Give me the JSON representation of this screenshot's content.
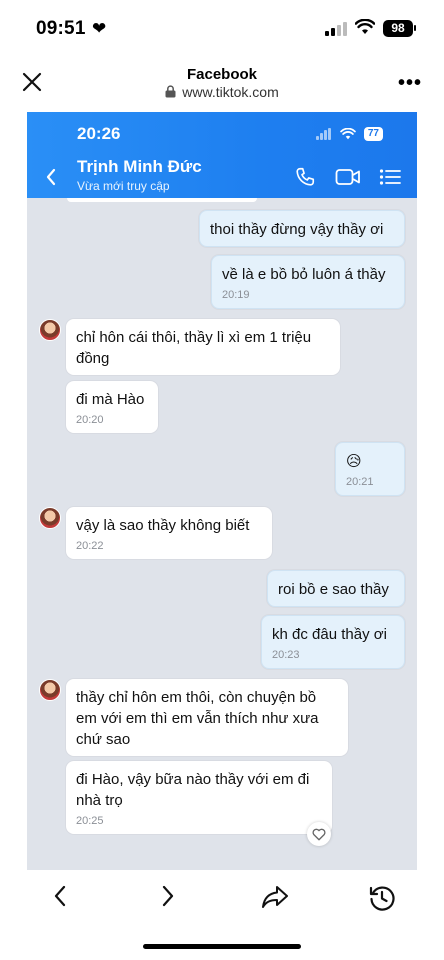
{
  "status_bar": {
    "time": "09:51",
    "battery": "98"
  },
  "browser": {
    "title": "Facebook",
    "url": "www.tiktok.com"
  },
  "chat": {
    "time": "20:26",
    "battery": "77",
    "contact_name": "Trịnh Minh Đức",
    "contact_status": "Vừa mới truy cập",
    "messages": [
      {
        "dir": "out",
        "text": "thoi thầy đừng vậy thầy ơi",
        "time": ""
      },
      {
        "dir": "out",
        "text": "về là e bồ bỏ luôn á thầy",
        "time": "20:19"
      },
      {
        "dir": "in",
        "text": "chỉ hôn cái thôi, thầy lì xì em 1 triệu đồng",
        "time": ""
      },
      {
        "dir": "in",
        "text": "đi mà Hào",
        "time": "20:20"
      },
      {
        "dir": "out",
        "text": "😥",
        "time": "20:21"
      },
      {
        "dir": "in",
        "text": "vậy là sao thầy không biết",
        "time": "20:22"
      },
      {
        "dir": "out",
        "text": "roi bồ e sao thầy",
        "time": ""
      },
      {
        "dir": "out",
        "text": "kh đc đâu thầy ơi",
        "time": "20:23"
      },
      {
        "dir": "in",
        "text": "thầy chỉ hôn em thôi, còn chuyện bồ em với em thì em vẫn thích như xưa chứ sao",
        "time": ""
      },
      {
        "dir": "in",
        "text": "đi Hào, vậy bữa nào thầy với em đi nhà trọ",
        "time": "20:25"
      }
    ]
  },
  "icons": {
    "close": "close-icon",
    "lock": "lock-icon",
    "more": "more-icon",
    "back": "back-arrow-icon",
    "phone": "phone-icon",
    "video": "video-call-icon",
    "menu": "list-menu-icon",
    "heart": "heart-icon",
    "nav_back": "chevron-left-icon",
    "nav_forward": "chevron-right-icon",
    "share": "share-icon",
    "history": "history-icon"
  },
  "colors": {
    "header_blue": "#1e7ff0",
    "out_bubble": "#e4f1fb",
    "in_bubble": "#ffffff",
    "chat_bg": "#dfe3ea"
  }
}
